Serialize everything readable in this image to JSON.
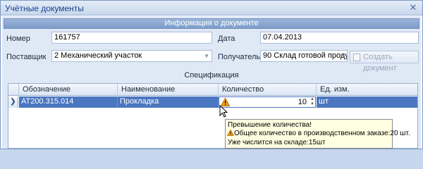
{
  "window": {
    "title": "Учётные документы",
    "close_glyph": "✕"
  },
  "header": {
    "group_title": "Информация о документе"
  },
  "form": {
    "number_label": "Номер",
    "number_value": "161757",
    "date_label": "Дата",
    "date_value": "07.04.2013",
    "supplier_label": "Поставщик",
    "supplier_value": "2 Механический участок",
    "receiver_label": "Получатель",
    "receiver_value": "90 Склад готовой продук...",
    "create_button": "Создать документ"
  },
  "spec": {
    "title": "Спецификация",
    "columns": [
      "Обозначение",
      "Наименование",
      "Количество",
      "Ед. изм."
    ],
    "rows": [
      {
        "designation": "АТ200.315.014",
        "name": "Прокладка",
        "quantity": "10",
        "unit": "шт"
      }
    ]
  },
  "tooltip": {
    "line1": "Превышение количества!",
    "line2": "Общее количество в производственном заказе:20 шт.",
    "line3": "Уже числится на складе:15шт"
  },
  "colors": {
    "selection": "#4b77c0",
    "header": "#7c9cc9",
    "tooltip_bg": "#ffffe1",
    "warning": "#f0a020"
  },
  "icons": {
    "warning": "warning-icon",
    "row_indicator": "current-row-arrow-icon"
  }
}
